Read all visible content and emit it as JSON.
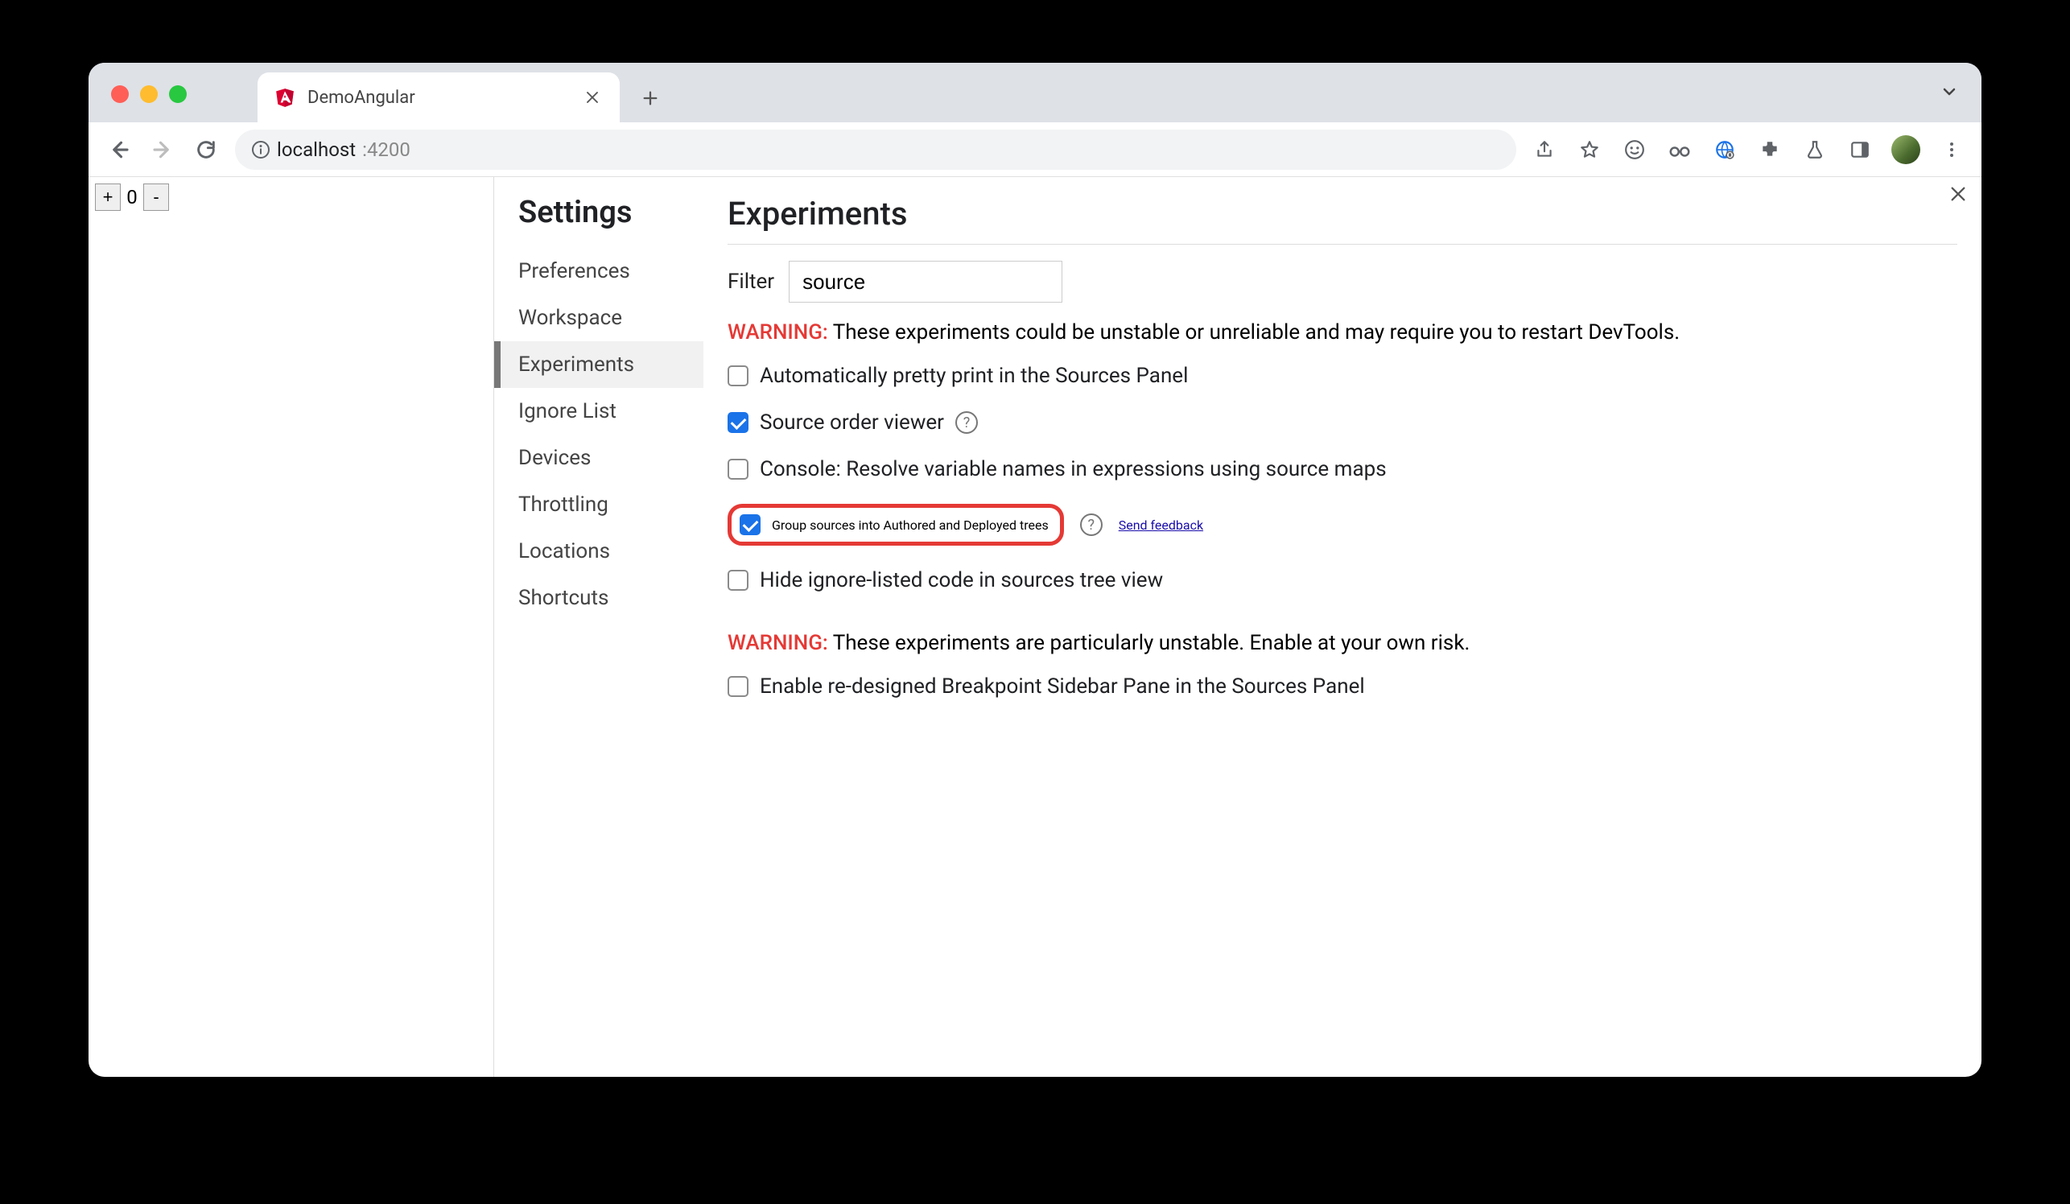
{
  "tab": {
    "title": "DemoAngular"
  },
  "omnibox": {
    "host": "localhost",
    "port": ":4200"
  },
  "page": {
    "counter": {
      "plus": "+",
      "value": "0",
      "minus": "-"
    }
  },
  "settings": {
    "title": "Settings",
    "nav": [
      "Preferences",
      "Workspace",
      "Experiments",
      "Ignore List",
      "Devices",
      "Throttling",
      "Locations",
      "Shortcuts"
    ],
    "active_index": 2
  },
  "experiments": {
    "title": "Experiments",
    "filter_label": "Filter",
    "filter_value": "source",
    "warning1_label": "WARNING:",
    "warning1_text": " These experiments could be unstable or unreliable and may require you to restart DevTools.",
    "warning2_label": "WARNING:",
    "warning2_text": " These experiments are particularly unstable. Enable at your own risk.",
    "items": [
      {
        "label": "Automatically pretty print in the Sources Panel",
        "checked": false,
        "help": false
      },
      {
        "label": "Source order viewer",
        "checked": true,
        "help": true
      },
      {
        "label": "Console: Resolve variable names in expressions using source maps",
        "checked": false,
        "help": false
      },
      {
        "label": "Group sources into Authored and Deployed trees",
        "checked": true,
        "help": true,
        "feedback": true,
        "highlight": true
      },
      {
        "label": "Hide ignore-listed code in sources tree view",
        "checked": false,
        "help": false
      }
    ],
    "unstable": [
      {
        "label": "Enable re-designed Breakpoint Sidebar Pane in the Sources Panel",
        "checked": false
      }
    ],
    "feedback_link": "Send feedback"
  }
}
